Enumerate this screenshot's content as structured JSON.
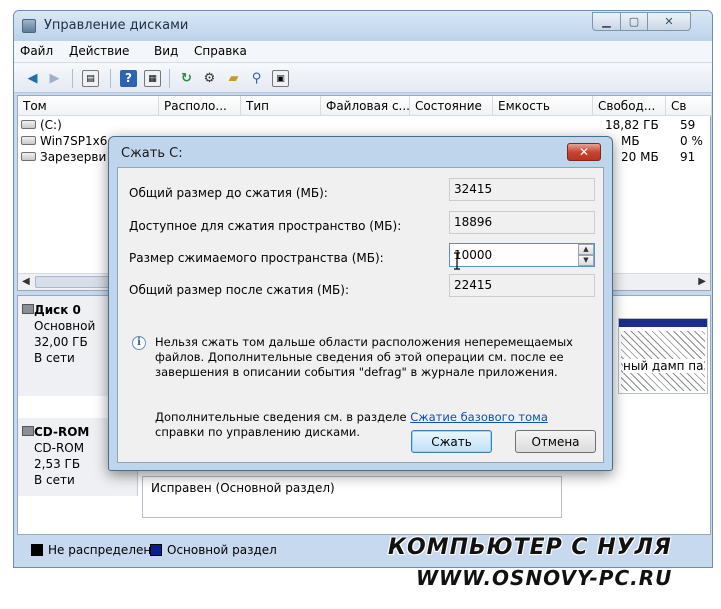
{
  "window": {
    "title": "Управление дисками",
    "min_glyph": "▁",
    "max_glyph": "▢",
    "close_glyph": "✕"
  },
  "menu": [
    "Файл",
    "Действие",
    "Вид",
    "Справка"
  ],
  "toolbar_icons": [
    "back-arrow-icon",
    "forward-arrow-icon",
    "console-tree-icon",
    "help-icon",
    "properties-icon",
    "refresh-icon",
    "settings-icon",
    "open-folder-icon",
    "search-icon",
    "properties-sheet-icon"
  ],
  "volume_list": {
    "columns": [
      "Том",
      "Располо...",
      "Тип",
      "Файловая с...",
      "Состояние",
      "Емкость",
      "Свобод...",
      "Св"
    ],
    "rows": [
      {
        "name": "(C:)",
        "free": "18,82 ГБ",
        "free_pct": "59"
      },
      {
        "name": "Win7SP1x6",
        "free": "МБ",
        "free_pct": "0 %"
      },
      {
        "name": "Зарезерви",
        "free": "20 МБ",
        "free_pct": "91"
      }
    ]
  },
  "disks": [
    {
      "name": "Диск 0",
      "type": "Основной",
      "size": "32,00 ГБ",
      "status": "В сети",
      "partition_text": "ный дамп па"
    },
    {
      "name": "CD-ROM",
      "type": "CD-ROM",
      "size": "2,53 ГБ",
      "status": "В сети",
      "partition_text": "Исправен (Основной раздел)"
    }
  ],
  "legend": {
    "unallocated": "Не распределен",
    "primary": "Основной раздел",
    "unallocated_color": "#000000",
    "primary_color": "#0a1f8f"
  },
  "dialog": {
    "title": "Сжать C:",
    "close_glyph": "✕",
    "total_label": "Общий размер до сжатия (МБ):",
    "total_value": "32415",
    "available_label": "Доступное для сжатия пространство (МБ):",
    "available_value": "18896",
    "shrink_label": "Размер сжимаемого пространства (МБ):",
    "shrink_value": "10000",
    "after_label": "Общий размер после сжатия (МБ):",
    "after_value": "22415",
    "info_glyph": "i",
    "info_text": "Нельзя сжать том дальше области расположения неперемещаемых файлов. Дополнительные сведения об этой операции см. после ее завершения в описании события \"defrag\" в журнале приложения.",
    "more_prefix": "Дополнительные сведения см. в разделе ",
    "more_link": "Сжатие базового тома",
    "more_suffix": " справки по управлению дисками.",
    "shrink_button": "Сжать",
    "cancel_button": "Отмена"
  },
  "watermark": {
    "line1": "КОМПЬЮТЕР С НУЛЯ",
    "line2": "WWW.OSNOVY-PC.RU"
  }
}
